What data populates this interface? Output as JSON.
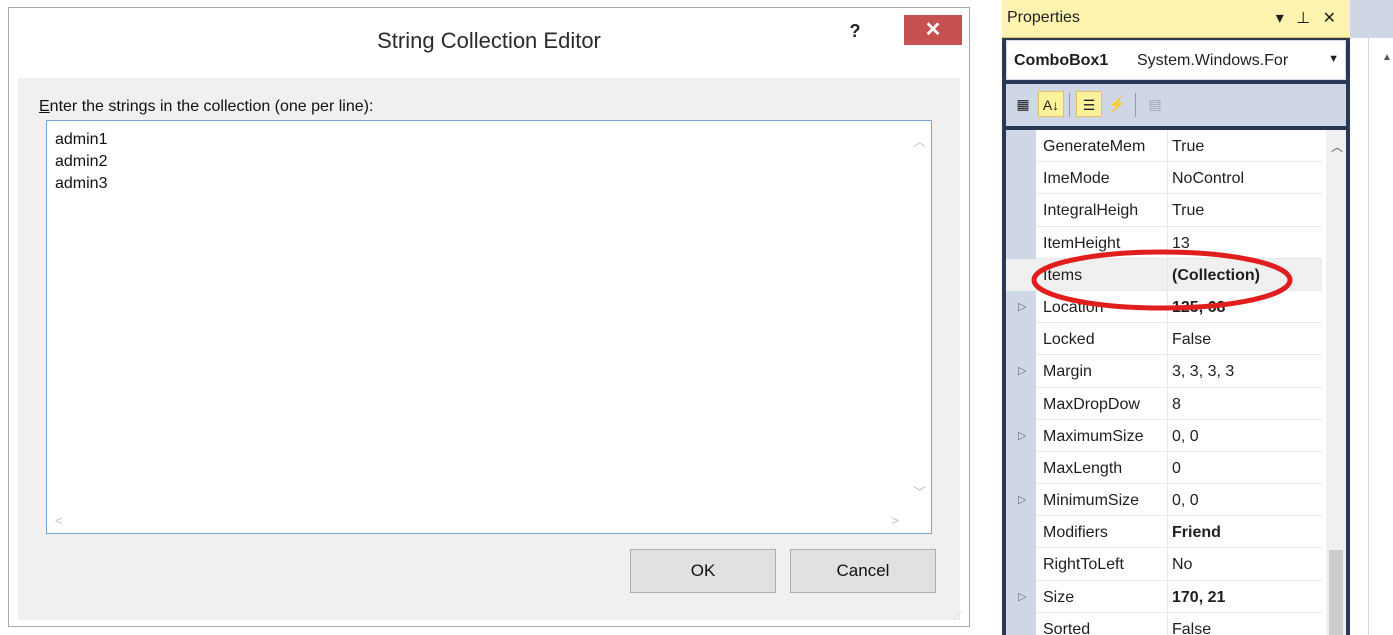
{
  "dialog": {
    "title": "String Collection Editor",
    "help": "?",
    "close": "✕",
    "prompt_first_letter": "E",
    "prompt_rest": "nter the strings in the collection (one per line):",
    "lines": "admin1\nadmin2\nadmin3",
    "ok_label": "OK",
    "cancel_label": "Cancel"
  },
  "properties": {
    "panel_title": "Properties",
    "title_tools": "▾ ⊥ ✕",
    "object_name": "ComboBox1",
    "object_type": "System.Windows.For",
    "rows": [
      {
        "name": "GenerateMem",
        "value": "True",
        "expandable": false,
        "bold": false
      },
      {
        "name": "ImeMode",
        "value": "NoControl",
        "expandable": false,
        "bold": false
      },
      {
        "name": "IntegralHeigh",
        "value": "True",
        "expandable": false,
        "bold": false
      },
      {
        "name": "ItemHeight",
        "value": "13",
        "expandable": false,
        "bold": false
      },
      {
        "name": "Items",
        "value": "(Collection)",
        "expandable": false,
        "bold": true
      },
      {
        "name": "Location",
        "value": "125, 68",
        "expandable": true,
        "bold": true
      },
      {
        "name": "Locked",
        "value": "False",
        "expandable": false,
        "bold": false
      },
      {
        "name": "Margin",
        "value": "3, 3, 3, 3",
        "expandable": true,
        "bold": false
      },
      {
        "name": "MaxDropDow",
        "value": "8",
        "expandable": false,
        "bold": false
      },
      {
        "name": "MaximumSize",
        "value": "0, 0",
        "expandable": true,
        "bold": false
      },
      {
        "name": "MaxLength",
        "value": "0",
        "expandable": false,
        "bold": false
      },
      {
        "name": "MinimumSize",
        "value": "0, 0",
        "expandable": true,
        "bold": false
      },
      {
        "name": "Modifiers",
        "value": "Friend",
        "expandable": false,
        "bold": true
      },
      {
        "name": "RightToLeft",
        "value": "No",
        "expandable": false,
        "bold": false
      },
      {
        "name": "Size",
        "value": "170, 21",
        "expandable": true,
        "bold": true
      },
      {
        "name": "Sorted",
        "value": "False",
        "expandable": false,
        "bold": false
      }
    ],
    "highlight_color": "#e01e1e"
  },
  "colors": {
    "close_button": "#c75050",
    "title_bar_active": "#fff3b0",
    "panel_bg": "#293955"
  }
}
